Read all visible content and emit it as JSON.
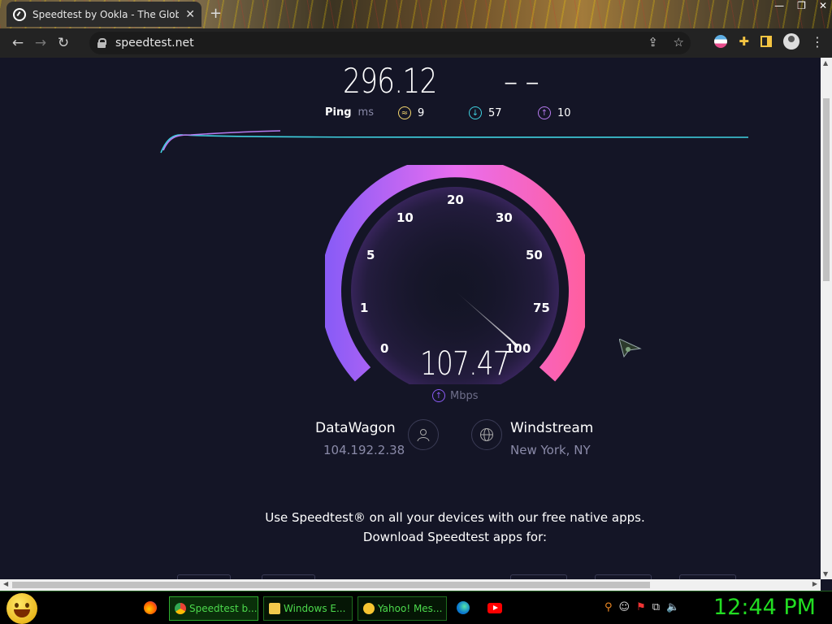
{
  "browser": {
    "tab_title": "Speedtest by Ookla - The Global",
    "tab_close": "✕",
    "new_tab": "+",
    "url": "speedtest.net",
    "window_controls": [
      "—",
      "❐",
      "✕"
    ]
  },
  "results": {
    "download_value": "296.12",
    "upload_value": "– –",
    "ping_label": "Ping",
    "ping_unit": "ms",
    "jitter": "9",
    "download_ping": "57",
    "upload_ping": "10"
  },
  "gauge": {
    "ticks": [
      "0",
      "1",
      "5",
      "10",
      "20",
      "30",
      "50",
      "75",
      "100"
    ],
    "current_value": 107.47,
    "display_value": "107.47",
    "unit": "Mbps",
    "colors": {
      "start": "#8b5cf6",
      "end": "#ff5fa2"
    }
  },
  "server": {
    "isp_name": "DataWagon",
    "isp_ip": "104.192.2.38",
    "host_name": "Windstream",
    "host_location": "New York, NY"
  },
  "promo": {
    "line1": "Use Speedtest® on all your devices with our free native apps.",
    "line2": "Download Speedtest apps for:"
  },
  "taskbar": {
    "chrome_label": "Speedtest b...",
    "explorer_label": "Windows E...",
    "yahoo_label": "Yahoo! Mes...",
    "clock": "12:44 PM"
  }
}
